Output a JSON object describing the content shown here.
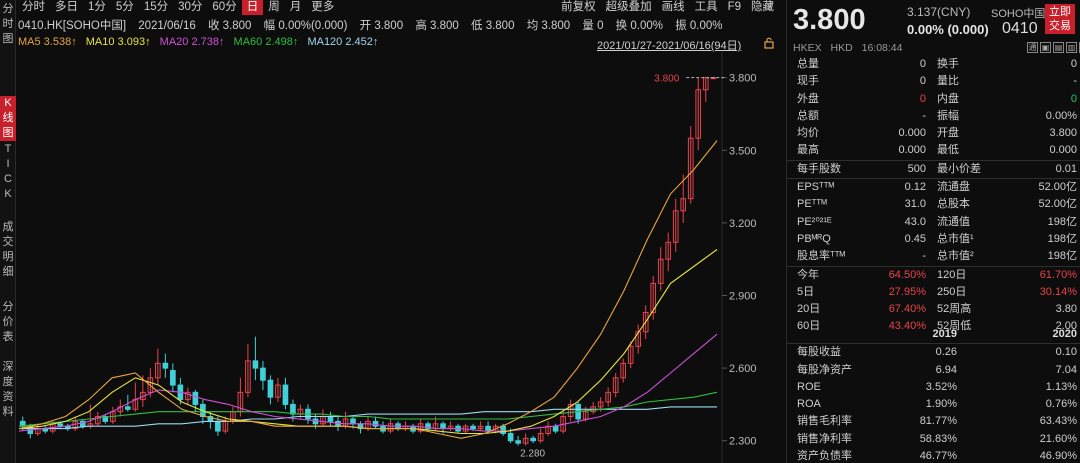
{
  "side_tabs": [
    {
      "label": "分\n时\n图",
      "active": false
    },
    {
      "label": "K\n线\n图",
      "active": true
    },
    {
      "label": "T\nI\nC\nK",
      "active": false
    },
    {
      "label": "成\n交\n明\n细",
      "active": false
    },
    {
      "label": "分\n价\n表",
      "active": false
    },
    {
      "label": "深\n度\n资\n料",
      "active": false
    }
  ],
  "toolbar": {
    "periods": [
      "分时",
      "多日",
      "1分",
      "5分",
      "15分",
      "30分",
      "60分",
      "日",
      "周",
      "月",
      "更多"
    ],
    "active_period": "日",
    "right": [
      "前复权",
      "超级叠加",
      "画线",
      "工具",
      "F9",
      "隐藏"
    ],
    "close": "×"
  },
  "info": {
    "symbol": "0410.HK[SOHO中国]",
    "date": "2021/06/16",
    "close": "收 3.800",
    "amplitude_change": "幅 0.00%(0.000)",
    "open": "开 3.800",
    "high": "高 3.800",
    "low": "低 3.800",
    "avg": "均 3.800",
    "volume": "量 0",
    "turnover": "换 0.00%",
    "swing": "振 0.00%"
  },
  "ma": {
    "ma5": "MA5 3.538↑",
    "ma10": "MA10 3.093↑",
    "ma20": "MA20 2.738↑",
    "ma60": "MA60 2.498↑",
    "ma120": "MA120 2.452↑",
    "colors": {
      "ma5": "#e8a640",
      "ma10": "#e8e43a",
      "ma20": "#d04fd6",
      "ma60": "#2fbf3f",
      "ma120": "#9fd8f0"
    },
    "range": "2021/01/27-2021/06/16(94日)"
  },
  "chart_data": {
    "type": "candlestick",
    "y_ticks": [
      "3.800",
      "3.500",
      "3.200",
      "2.900",
      "2.600",
      "2.300"
    ],
    "ylim": [
      2.27,
      3.84
    ],
    "annotations": {
      "high": "3.800",
      "low": "2.280"
    },
    "candles": [
      [
        2.38,
        2.36,
        2.4,
        2.34
      ],
      [
        2.36,
        2.33,
        2.37,
        2.31
      ],
      [
        2.33,
        2.35,
        2.37,
        2.32
      ],
      [
        2.35,
        2.34,
        2.36,
        2.33
      ],
      [
        2.34,
        2.37,
        2.38,
        2.33
      ],
      [
        2.37,
        2.36,
        2.38,
        2.35
      ],
      [
        2.36,
        2.35,
        2.37,
        2.34
      ],
      [
        2.35,
        2.38,
        2.4,
        2.34
      ],
      [
        2.38,
        2.36,
        2.39,
        2.35
      ],
      [
        2.36,
        2.37,
        2.45,
        2.35
      ],
      [
        2.37,
        2.4,
        2.42,
        2.36
      ],
      [
        2.4,
        2.38,
        2.41,
        2.37
      ],
      [
        2.38,
        2.42,
        2.44,
        2.37
      ],
      [
        2.42,
        2.44,
        2.47,
        2.4
      ],
      [
        2.44,
        2.43,
        2.49,
        2.42
      ],
      [
        2.43,
        2.47,
        2.54,
        2.42
      ],
      [
        2.47,
        2.5,
        2.57,
        2.44
      ],
      [
        2.5,
        2.56,
        2.6,
        2.48
      ],
      [
        2.56,
        2.62,
        2.68,
        2.53
      ],
      [
        2.62,
        2.6,
        2.66,
        2.56
      ],
      [
        2.59,
        2.53,
        2.62,
        2.5
      ],
      [
        2.53,
        2.47,
        2.56,
        2.45
      ],
      [
        2.47,
        2.5,
        2.52,
        2.45
      ],
      [
        2.5,
        2.45,
        2.51,
        2.42
      ],
      [
        2.45,
        2.4,
        2.47,
        2.37
      ],
      [
        2.4,
        2.38,
        2.42,
        2.35
      ],
      [
        2.38,
        2.34,
        2.4,
        2.32
      ],
      [
        2.34,
        2.38,
        2.4,
        2.33
      ],
      [
        2.38,
        2.42,
        2.44,
        2.37
      ],
      [
        2.42,
        2.5,
        2.56,
        2.4
      ],
      [
        2.5,
        2.63,
        2.7,
        2.48
      ],
      [
        2.63,
        2.6,
        2.73,
        2.55
      ],
      [
        2.6,
        2.55,
        2.63,
        2.51
      ],
      [
        2.55,
        2.48,
        2.57,
        2.45
      ],
      [
        2.48,
        2.53,
        2.56,
        2.46
      ],
      [
        2.53,
        2.45,
        2.56,
        2.43
      ],
      [
        2.45,
        2.41,
        2.47,
        2.38
      ],
      [
        2.41,
        2.43,
        2.45,
        2.39
      ],
      [
        2.43,
        2.39,
        2.45,
        2.37
      ],
      [
        2.39,
        2.37,
        2.41,
        2.35
      ],
      [
        2.37,
        2.4,
        2.43,
        2.36
      ],
      [
        2.4,
        2.38,
        2.42,
        2.36
      ],
      [
        2.38,
        2.36,
        2.4,
        2.34
      ],
      [
        2.36,
        2.39,
        2.42,
        2.35
      ],
      [
        2.39,
        2.37,
        2.4,
        2.35
      ],
      [
        2.37,
        2.35,
        2.38,
        2.33
      ],
      [
        2.35,
        2.38,
        2.4,
        2.34
      ],
      [
        2.38,
        2.36,
        2.4,
        2.35
      ],
      [
        2.36,
        2.34,
        2.38,
        2.33
      ],
      [
        2.34,
        2.37,
        2.39,
        2.33
      ],
      [
        2.37,
        2.35,
        2.38,
        2.34
      ],
      [
        2.35,
        2.36,
        2.38,
        2.34
      ],
      [
        2.36,
        2.34,
        2.37,
        2.33
      ],
      [
        2.34,
        2.37,
        2.39,
        2.33
      ],
      [
        2.37,
        2.35,
        2.38,
        2.34
      ],
      [
        2.35,
        2.37,
        2.4,
        2.34
      ],
      [
        2.37,
        2.35,
        2.38,
        2.33
      ],
      [
        2.35,
        2.36,
        2.38,
        2.34
      ],
      [
        2.36,
        2.34,
        2.37,
        2.33
      ],
      [
        2.34,
        2.36,
        2.37,
        2.33
      ],
      [
        2.36,
        2.35,
        2.37,
        2.34
      ],
      [
        2.35,
        2.36,
        2.38,
        2.34
      ],
      [
        2.36,
        2.34,
        2.38,
        2.33
      ],
      [
        2.34,
        2.36,
        2.37,
        2.33
      ],
      [
        2.36,
        2.33,
        2.37,
        2.32
      ],
      [
        2.33,
        2.3,
        2.35,
        2.29
      ],
      [
        2.3,
        2.29,
        2.32,
        2.28
      ],
      [
        2.29,
        2.31,
        2.33,
        2.28
      ],
      [
        2.31,
        2.3,
        2.32,
        2.29
      ],
      [
        2.3,
        2.33,
        2.35,
        2.29
      ],
      [
        2.33,
        2.36,
        2.38,
        2.32
      ],
      [
        2.36,
        2.34,
        2.37,
        2.33
      ],
      [
        2.34,
        2.4,
        2.42,
        2.33
      ],
      [
        2.4,
        2.45,
        2.47,
        2.38
      ],
      [
        2.45,
        2.39,
        2.46,
        2.37
      ],
      [
        2.39,
        2.42,
        2.44,
        2.38
      ],
      [
        2.42,
        2.44,
        2.46,
        2.41
      ],
      [
        2.44,
        2.46,
        2.48,
        2.42
      ],
      [
        2.46,
        2.5,
        2.52,
        2.44
      ],
      [
        2.5,
        2.56,
        2.58,
        2.48
      ],
      [
        2.56,
        2.62,
        2.64,
        2.54
      ],
      [
        2.62,
        2.69,
        2.71,
        2.6
      ],
      [
        2.69,
        2.75,
        2.78,
        2.66
      ],
      [
        2.75,
        2.83,
        2.86,
        2.72
      ],
      [
        2.83,
        2.95,
        2.98,
        2.8
      ],
      [
        2.95,
        3.05,
        3.1,
        2.92
      ],
      [
        3.05,
        3.12,
        3.16,
        3.0
      ],
      [
        3.12,
        3.25,
        3.3,
        3.08
      ],
      [
        3.25,
        3.3,
        3.4,
        3.2
      ],
      [
        3.3,
        3.55,
        3.6,
        3.28
      ],
      [
        3.55,
        3.75,
        3.8,
        3.5
      ],
      [
        3.75,
        3.8,
        3.8,
        3.7
      ],
      [
        3.8,
        3.8,
        3.8,
        3.8
      ]
    ],
    "ma_lines": {
      "ma120": [
        2.35,
        2.35,
        2.35,
        2.36,
        2.36,
        2.36,
        2.37,
        2.37,
        2.38,
        2.38,
        2.39,
        2.39,
        2.4,
        2.4,
        2.4,
        2.41,
        2.41,
        2.41,
        2.41,
        2.41,
        2.42,
        2.42,
        2.42,
        2.43,
        2.43,
        2.43,
        2.43,
        2.43,
        2.44,
        2.44,
        2.44
      ],
      "ma60": [
        2.36,
        2.37,
        2.38,
        2.39,
        2.4,
        2.41,
        2.42,
        2.42,
        2.42,
        2.42,
        2.42,
        2.42,
        2.41,
        2.41,
        2.4,
        2.4,
        2.39,
        2.39,
        2.39,
        2.39,
        2.39,
        2.39,
        2.4,
        2.41,
        2.42,
        2.43,
        2.44,
        2.46,
        2.47,
        2.48,
        2.5
      ],
      "ma20": [
        2.34,
        2.35,
        2.36,
        2.38,
        2.42,
        2.47,
        2.51,
        2.5,
        2.47,
        2.45,
        2.42,
        2.4,
        2.39,
        2.38,
        2.37,
        2.37,
        2.36,
        2.36,
        2.35,
        2.35,
        2.34,
        2.34,
        2.35,
        2.36,
        2.38,
        2.4,
        2.44,
        2.5,
        2.58,
        2.66,
        2.74
      ],
      "ma10": [
        2.35,
        2.36,
        2.38,
        2.42,
        2.5,
        2.56,
        2.53,
        2.46,
        2.42,
        2.39,
        2.38,
        2.37,
        2.36,
        2.36,
        2.36,
        2.35,
        2.35,
        2.35,
        2.34,
        2.33,
        2.33,
        2.34,
        2.36,
        2.4,
        2.46,
        2.55,
        2.66,
        2.8,
        2.95,
        3.02,
        3.09
      ],
      "ma5": [
        2.35,
        2.37,
        2.4,
        2.47,
        2.56,
        2.58,
        2.5,
        2.43,
        2.4,
        2.38,
        2.38,
        2.36,
        2.36,
        2.36,
        2.36,
        2.35,
        2.35,
        2.35,
        2.33,
        2.31,
        2.33,
        2.37,
        2.42,
        2.48,
        2.6,
        2.74,
        2.92,
        3.13,
        3.32,
        3.42,
        3.54
      ]
    }
  },
  "quote": {
    "price": "3.800",
    "cny": "3.137(CNY)",
    "change": "0.00% (0.000)",
    "name": "SOHO中国",
    "code": "0410",
    "trade_btn": "立即\n交易",
    "market": "HKEX",
    "currency": "HKD",
    "time": "16:08:44",
    "tool_icons": [
      "通",
      "▣",
      "▤",
      "▥",
      "▦",
      "▲"
    ]
  },
  "stats": [
    {
      "l1": "总量",
      "v1": "0",
      "c1": "dim",
      "l2": "换手",
      "v2": "0",
      "c2": "dim"
    },
    {
      "l1": "现手",
      "v1": "0",
      "c1": "dim",
      "l2": "量比",
      "v2": "-",
      "c2": "dim"
    },
    {
      "l1": "外盘",
      "v1": "0",
      "c1": "red",
      "l2": "内盘",
      "v2": "0",
      "c2": "green"
    },
    {
      "l1": "总额",
      "v1": "-",
      "c1": "dim",
      "l2": "振幅",
      "v2": "0.00%",
      "c2": "dim"
    },
    {
      "l1": "均价",
      "v1": "0.000",
      "c1": "dim",
      "l2": "开盘",
      "v2": "3.800",
      "c2": "dim"
    },
    {
      "l1": "最高",
      "v1": "0.000",
      "c1": "dim",
      "l2": "最低",
      "v2": "0.000",
      "c2": "dim",
      "sep_after": true
    },
    {
      "l1": "每手股数",
      "v1": "500",
      "c1": "dim",
      "l2": "最小价差",
      "v2": "0.01",
      "c2": "dim",
      "sep_after": true
    },
    {
      "l1": "EPSᵀᵀᴹ",
      "v1": "0.12",
      "c1": "dim",
      "l2": "流通盘",
      "v2": "52.00亿",
      "c2": "dim"
    },
    {
      "l1": "PEᵀᵀᴹ",
      "v1": "31.0",
      "c1": "dim",
      "l2": "总股本",
      "v2": "52.00亿",
      "c2": "dim"
    },
    {
      "l1": "PE²⁰²¹ᴱ",
      "v1": "43.0",
      "c1": "dim",
      "l2": "流通值",
      "v2": "198亿",
      "c2": "dim"
    },
    {
      "l1": "PBᴹᴿQ",
      "v1": "0.45",
      "c1": "dim",
      "l2": "总市值¹",
      "v2": "198亿",
      "c2": "dim"
    },
    {
      "l1": "股息率ᵀᵀᴹ",
      "v1": "-",
      "c1": "dim",
      "l2": "总市值²",
      "v2": "198亿",
      "c2": "dim",
      "sep_after": true
    },
    {
      "l1": "今年",
      "v1": "64.50%",
      "c1": "red",
      "l2": "120日",
      "v2": "61.70%",
      "c2": "red"
    },
    {
      "l1": "5日",
      "v1": "27.95%",
      "c1": "red",
      "l2": "250日",
      "v2": "30.14%",
      "c2": "red"
    },
    {
      "l1": "20日",
      "v1": "67.40%",
      "c1": "red",
      "l2": "52周高",
      "v2": "3.80",
      "c2": "dim"
    },
    {
      "l1": "60日",
      "v1": "43.40%",
      "c1": "red",
      "l2": "52周低",
      "v2": "2.00",
      "c2": "dim"
    }
  ],
  "financials": {
    "years": [
      "2019",
      "2020"
    ],
    "rows": [
      {
        "label": "每股收益",
        "v2019": "0.26",
        "v2020": "0.10"
      },
      {
        "label": "每股净资产",
        "v2019": "6.94",
        "v2020": "7.04"
      },
      {
        "label": "ROE",
        "v2019": "3.52%",
        "v2020": "1.13%"
      },
      {
        "label": "ROA",
        "v2019": "1.90%",
        "v2020": "0.76%"
      },
      {
        "label": "销售毛利率",
        "v2019": "81.77%",
        "v2020": "63.43%"
      },
      {
        "label": "销售净利率",
        "v2019": "58.83%",
        "v2020": "21.60%"
      },
      {
        "label": "资产负债率",
        "v2019": "46.77%",
        "v2020": "46.90%"
      }
    ]
  }
}
